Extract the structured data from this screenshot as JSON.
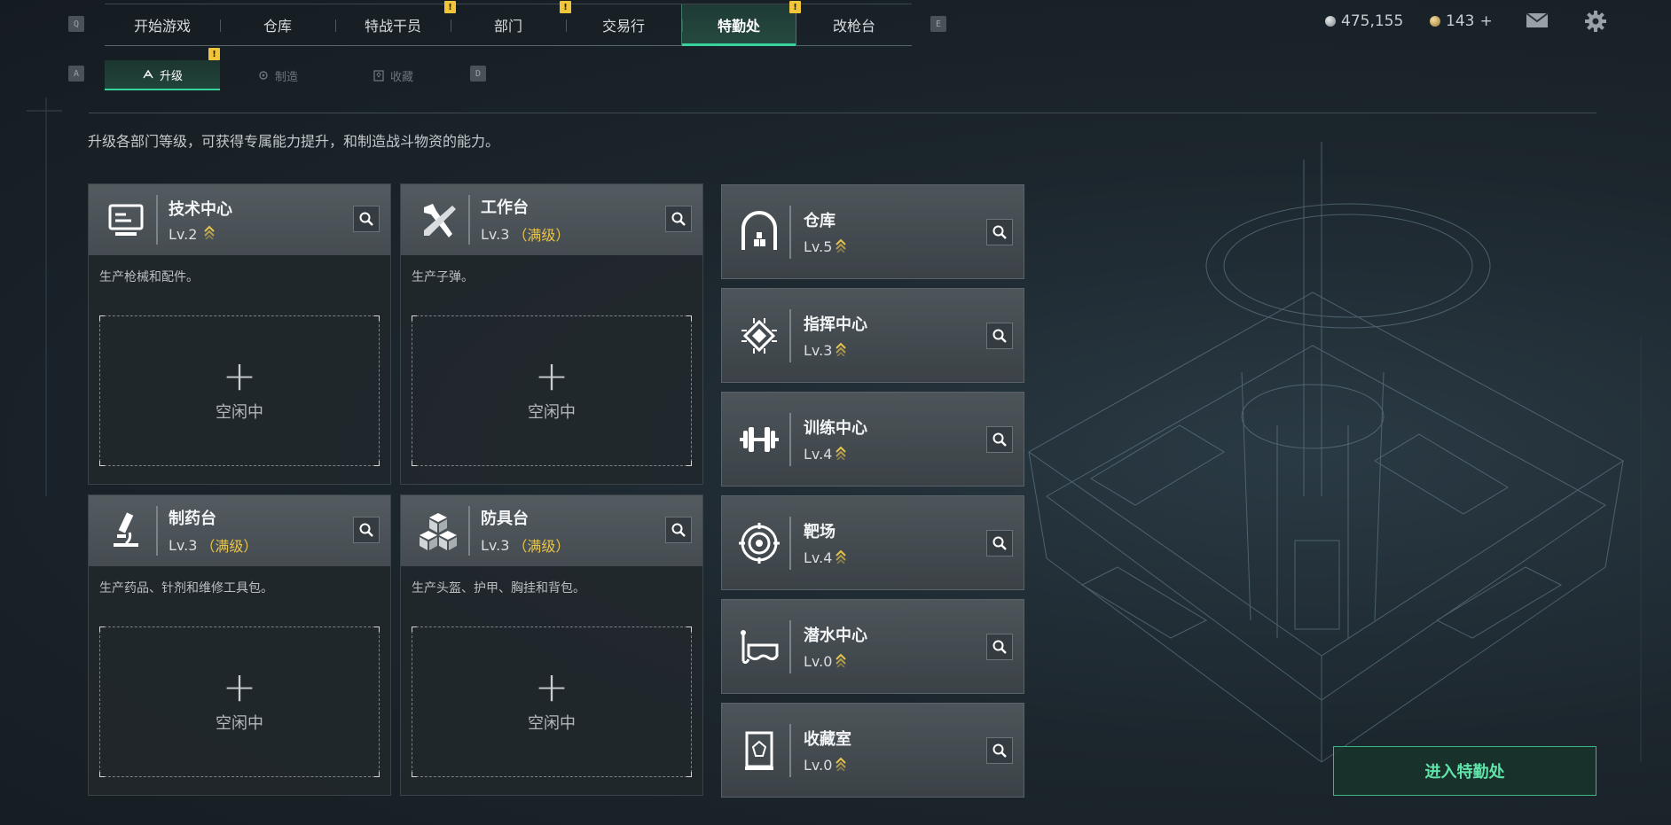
{
  "key_hints": {
    "left_main": "Q",
    "right_main": "E",
    "left_sub": "A",
    "right_sub": "D"
  },
  "top_tabs": [
    {
      "label": "开始游戏",
      "badge": ""
    },
    {
      "label": "仓库",
      "badge": ""
    },
    {
      "label": "特战干员",
      "badge": "!"
    },
    {
      "label": "部门",
      "badge": "!"
    },
    {
      "label": "交易行",
      "badge": ""
    },
    {
      "label": "特勤处",
      "badge": "!",
      "active": true
    },
    {
      "label": "改枪台",
      "badge": ""
    }
  ],
  "sub_tabs": [
    {
      "label": "升级",
      "active": true,
      "badge": "!"
    },
    {
      "label": "制造"
    },
    {
      "label": "收藏"
    }
  ],
  "currency": {
    "silver": "475,155",
    "gold": "143",
    "gold_add": "+"
  },
  "description": "升级各部门等级，可获得专属能力提升，和制造战斗物资的能力。",
  "work_cards": [
    {
      "title": "技术中心",
      "level": "Lv.2",
      "maxed": "",
      "desc": "生产枪械和配件。",
      "slot_plus": "+",
      "slot_status": "空闲中",
      "icon": "computer-icon"
    },
    {
      "title": "工作台",
      "level": "Lv.3",
      "maxed": "（满级）",
      "desc": "生产子弹。",
      "slot_plus": "+",
      "slot_status": "空闲中",
      "icon": "tools-icon"
    },
    {
      "title": "制药台",
      "level": "Lv.3",
      "maxed": "（满级）",
      "desc": "生产药品、针剂和维修工具包。",
      "slot_plus": "+",
      "slot_status": "空闲中",
      "icon": "microscope-icon"
    },
    {
      "title": "防具台",
      "level": "Lv.3",
      "maxed": "（满级）",
      "desc": "生产头盔、护甲、胸挂和背包。",
      "slot_plus": "+",
      "slot_status": "空闲中",
      "icon": "cubes-icon"
    }
  ],
  "facilities": [
    {
      "title": "仓库",
      "level": "Lv.5",
      "icon": "warehouse-icon"
    },
    {
      "title": "指挥中心",
      "level": "Lv.3",
      "icon": "chip-icon"
    },
    {
      "title": "训练中心",
      "level": "Lv.4",
      "icon": "dumbbell-icon"
    },
    {
      "title": "靶场",
      "level": "Lv.4",
      "icon": "target-icon"
    },
    {
      "title": "潜水中心",
      "level": "Lv.0",
      "icon": "diving-mask-icon"
    },
    {
      "title": "收藏室",
      "level": "Lv.0",
      "icon": "display-case-icon"
    }
  ],
  "enter_button": "进入特勤处",
  "colors": {
    "accent": "#37d39a",
    "warning": "#f0c53a",
    "maxed": "#e7c44c"
  }
}
